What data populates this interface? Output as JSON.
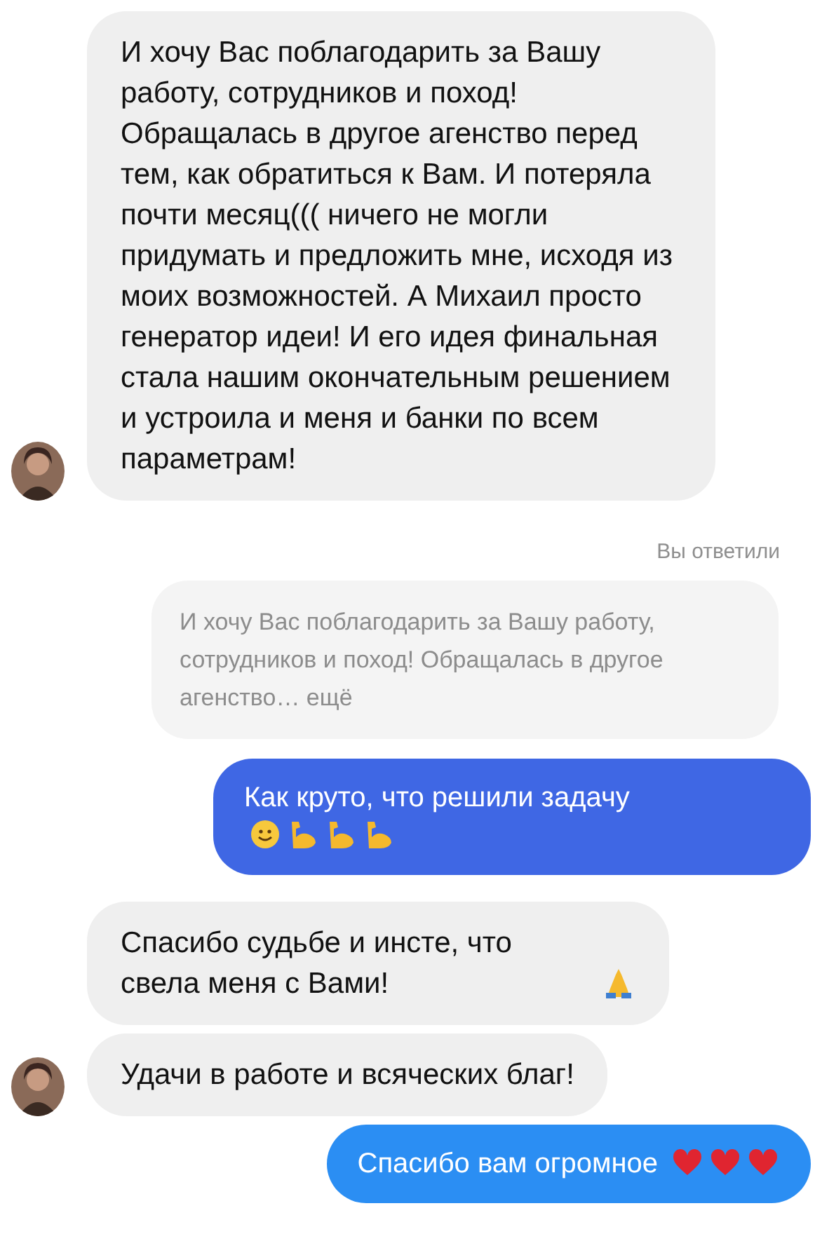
{
  "messages": [
    {
      "kind": "incoming",
      "text": "И хочу Вас поблагодарить за Вашу работу, сотрудников и поход! Обращалась в другое агенство перед тем, как обратиться к Вам. И потеряла почти месяц((( ничего не могли придумать и предложить мне, исходя из моих возможностей. А Михаил просто генератор идеи! И его идея финальная стала нашим окончательным решением и устроила и меня и банки по всем параметрам!",
      "avatar": true
    },
    {
      "kind": "reply-label",
      "text": "Вы ответили"
    },
    {
      "kind": "quote",
      "text": "И хочу Вас поблагодарить за Вашу работу, сотрудников и поход! Обращалась в другое агенство… ещё"
    },
    {
      "kind": "outgoing",
      "color": "#3f67e4",
      "text": "Как круто, что решили задачу",
      "emojis": [
        {
          "kind": "smile"
        },
        {
          "kind": "arm"
        },
        {
          "kind": "arm"
        },
        {
          "kind": "arm"
        }
      ]
    },
    {
      "kind": "incoming",
      "text": "Спасибо судьбе и инсте, что свела меня с Вами!",
      "emojis": [
        {
          "kind": "pray"
        }
      ],
      "avatar": false
    },
    {
      "kind": "incoming",
      "text": "Удачи в работе и всяческих благ!",
      "avatar": true
    },
    {
      "kind": "outgoing",
      "color": "#2b8ef3",
      "text": "Спасибо вам огромное",
      "emojis": [
        {
          "kind": "heart"
        },
        {
          "kind": "heart"
        },
        {
          "kind": "heart"
        }
      ]
    }
  ]
}
